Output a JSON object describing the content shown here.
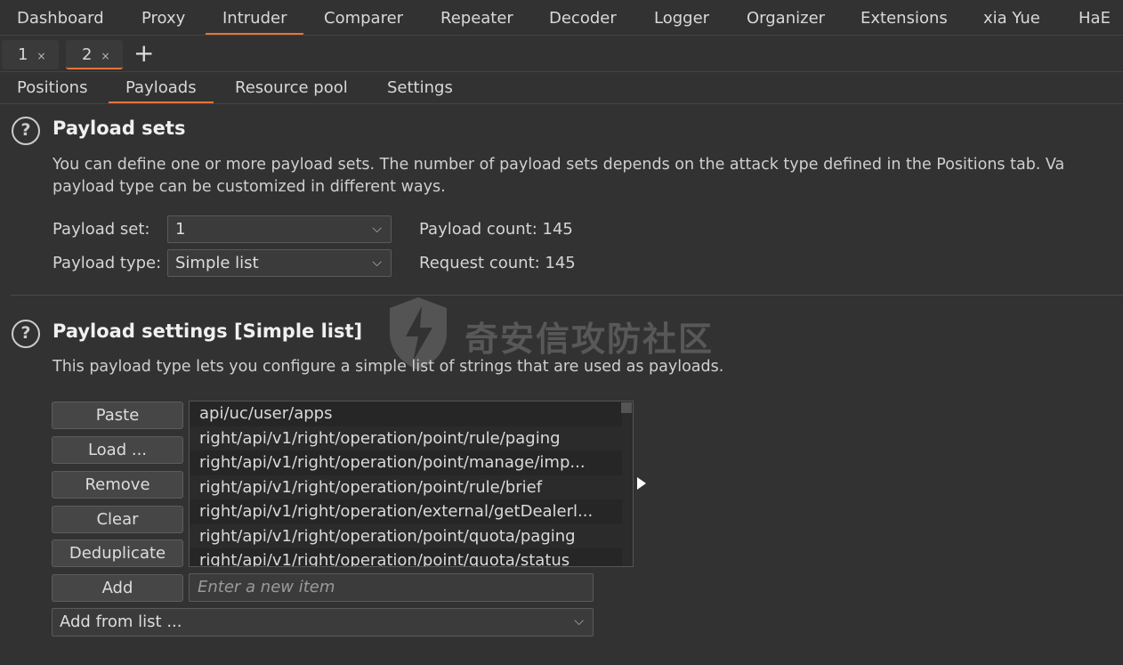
{
  "topnav": [
    "Dashboard",
    "Proxy",
    "Intruder",
    "Comparer",
    "Repeater",
    "Decoder",
    "Logger",
    "Organizer",
    "Extensions",
    "xia Yue",
    "HaE"
  ],
  "intruder_tabs": [
    {
      "label": "1",
      "close": "×"
    },
    {
      "label": "2",
      "close": "×"
    }
  ],
  "add_tab": "+",
  "content_tabs": [
    "Positions",
    "Payloads",
    "Resource pool",
    "Settings"
  ],
  "payload_sets": {
    "help": "?",
    "title": "Payload sets",
    "desc1": "You can define one or more payload sets. The number of payload sets depends on the attack type defined in the Positions tab. Va",
    "desc2": "payload type can be customized in different ways.",
    "set_label": "Payload set:",
    "set_value": "1",
    "type_label": "Payload type:",
    "type_value": "Simple list",
    "payload_count": "Payload count: 145",
    "request_count": "Request count: 145"
  },
  "payload_settings": {
    "help": "?",
    "title": "Payload settings [Simple list]",
    "desc": "This payload type lets you configure a simple list of strings that are used as payloads.",
    "buttons": [
      "Paste",
      "Load ...",
      "Remove",
      "Clear",
      "Deduplicate",
      "Add"
    ],
    "items": [
      "api/uc/user/apps",
      "right/api/v1/right/operation/point/rule/paging",
      "right/api/v1/right/operation/point/manage/imp...",
      "right/api/v1/right/operation/point/rule/brief",
      "right/api/v1/right/operation/external/getDealerl...",
      "right/api/v1/right/operation/point/quota/paging",
      "right/api/v1/right/operation/point/quota/status"
    ],
    "new_item_placeholder": "Enter a new item",
    "add_from_list": "Add from list ..."
  },
  "watermark": "奇安信攻防社区",
  "chevron": "⌵"
}
